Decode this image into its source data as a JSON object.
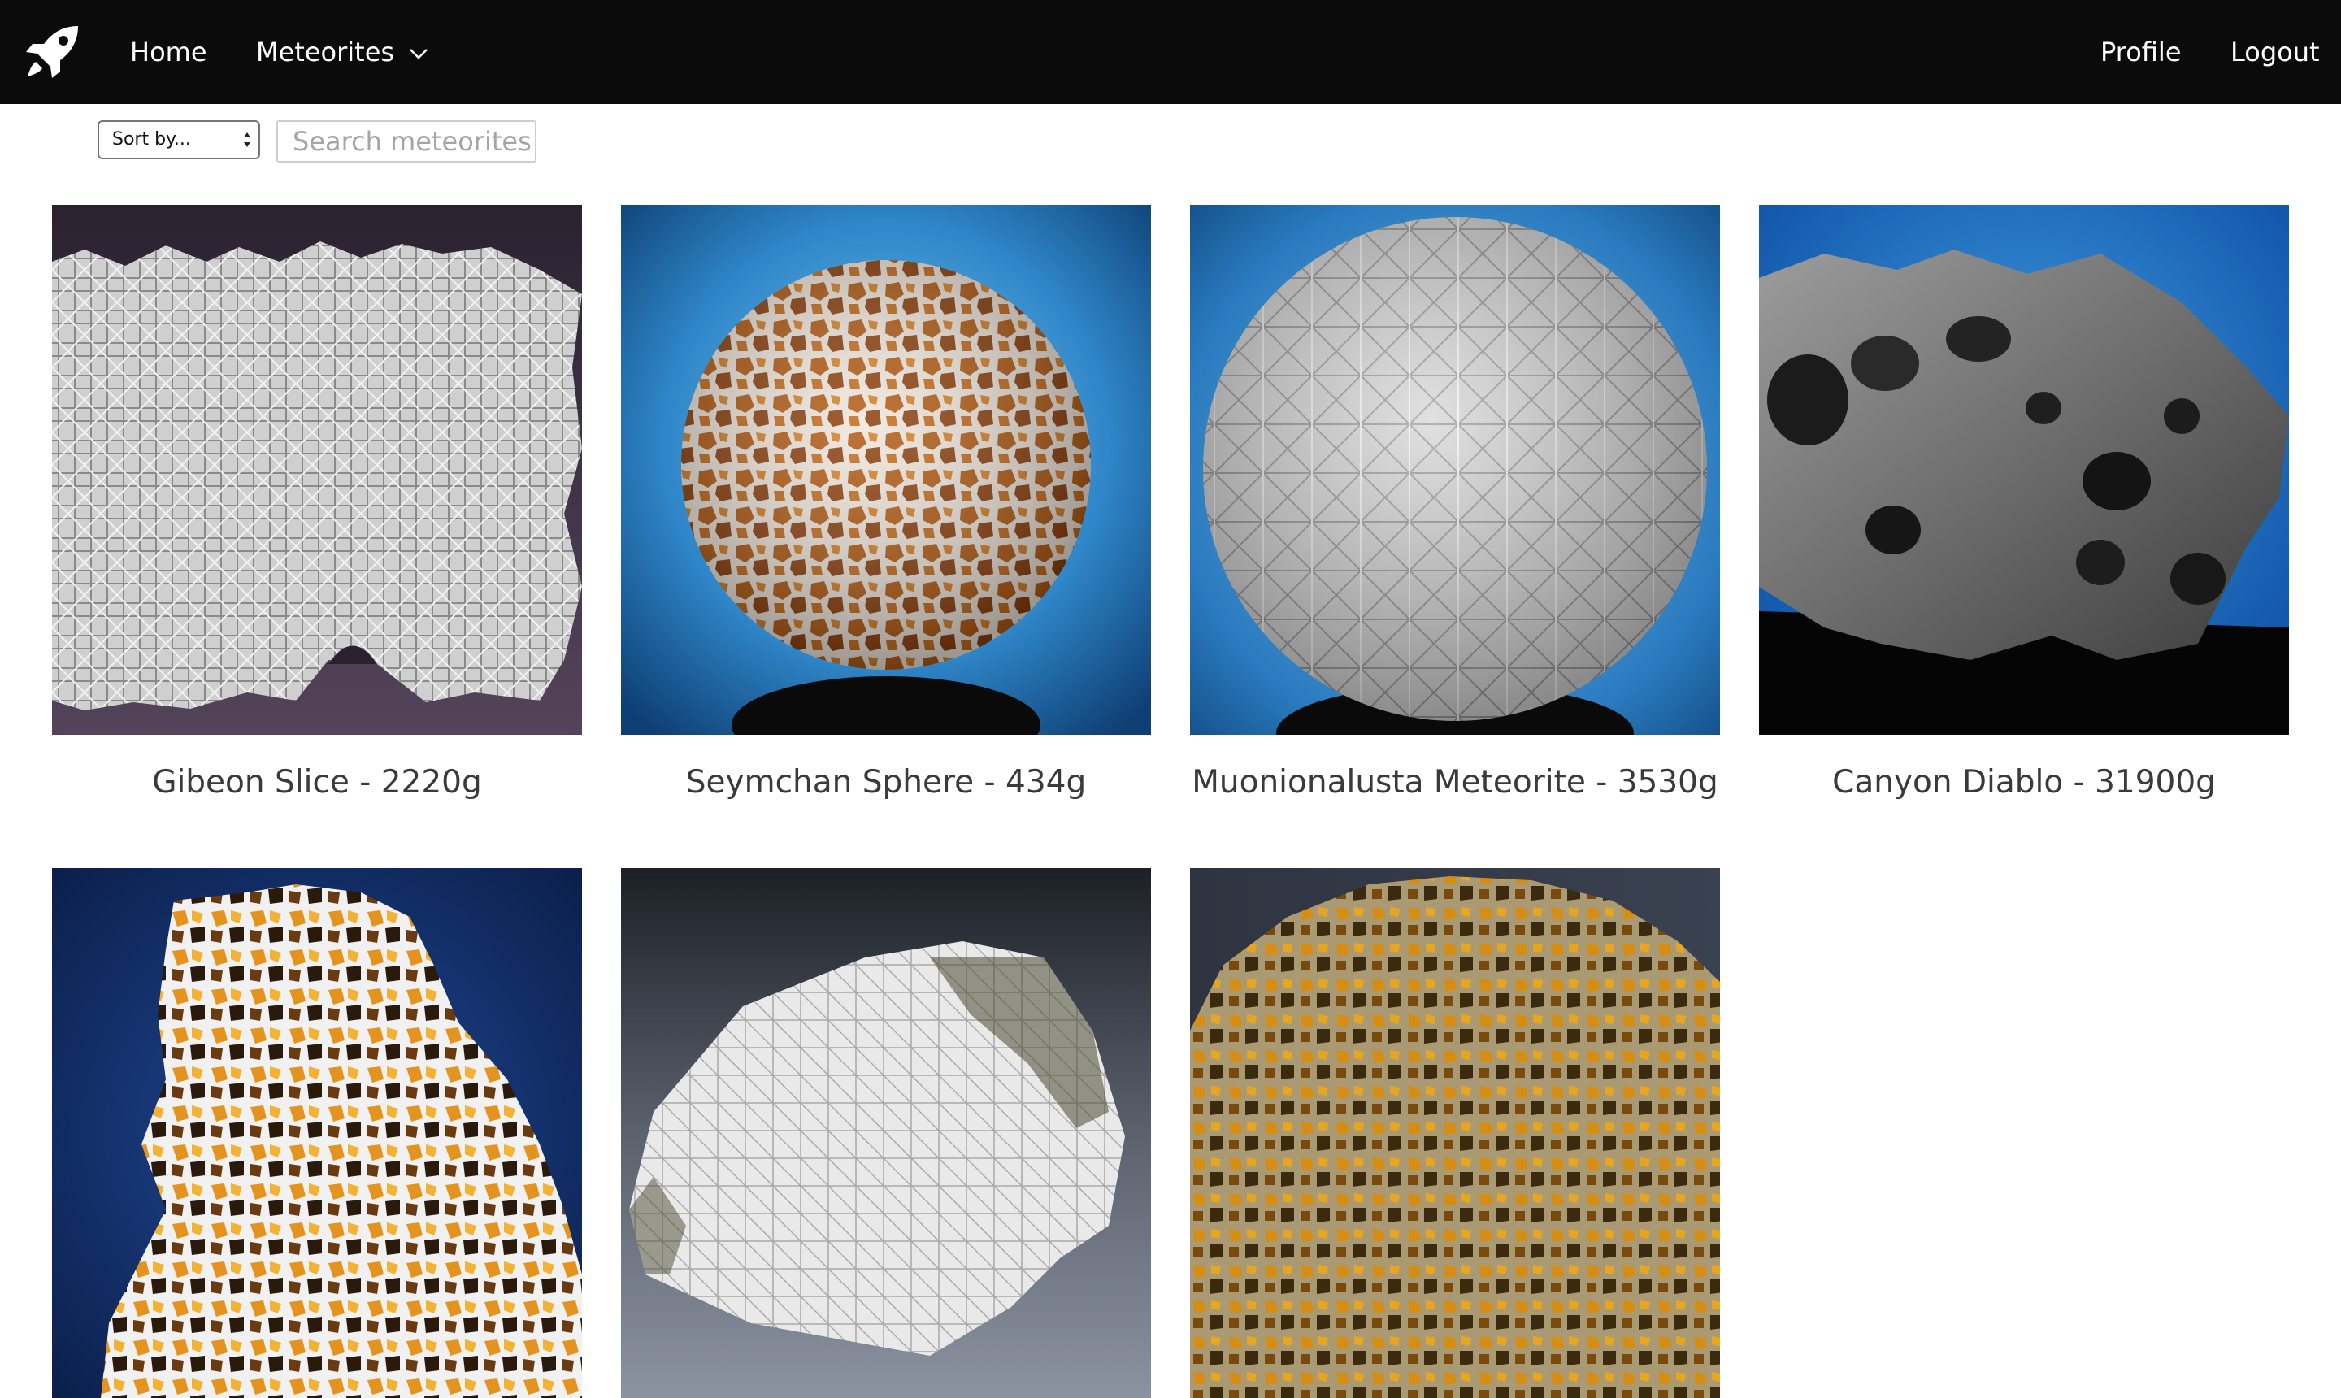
{
  "nav": {
    "home": "Home",
    "meteorites": "Meteorites",
    "profile": "Profile",
    "logout": "Logout"
  },
  "controls": {
    "sort_label": "Sort by...",
    "search_placeholder": "Search meteorites"
  },
  "cards": [
    {
      "caption": "Gibeon Slice - 2220g"
    },
    {
      "caption": "Seymchan Sphere - 434g"
    },
    {
      "caption": "Muonionalusta Meteorite - 3530g"
    },
    {
      "caption": "Canyon Diablo - 31900g"
    },
    {
      "caption": ""
    },
    {
      "caption": ""
    },
    {
      "caption": ""
    }
  ]
}
